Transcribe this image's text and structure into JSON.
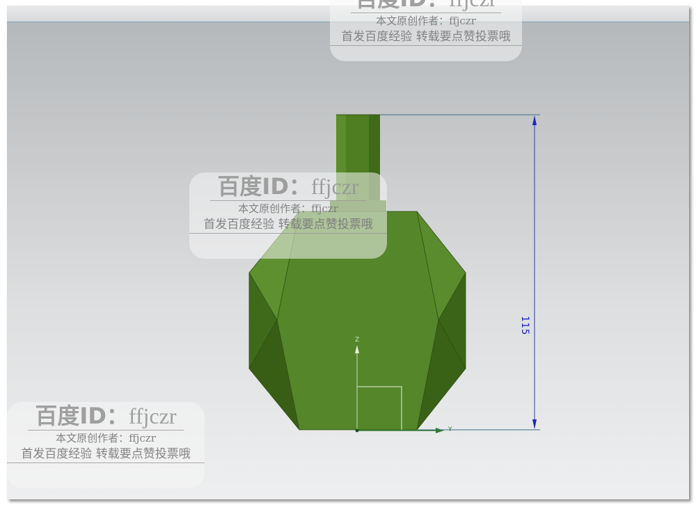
{
  "dimension": {
    "value": "115"
  },
  "axes": {
    "z_label": "Z",
    "y_label": "Y"
  },
  "watermark": {
    "id_prefix": "百度ID：",
    "id_user": "ffjczr",
    "author_line": "本文原创作者：ffjczr",
    "notice_line": "首发百度经验 转载要点赞投票哦"
  },
  "colors": {
    "model_green": "#4f7f25",
    "dimension_blue": "#1d24c9",
    "background_top": "#b3b6b8",
    "background_bottom": "#eeeff0"
  }
}
